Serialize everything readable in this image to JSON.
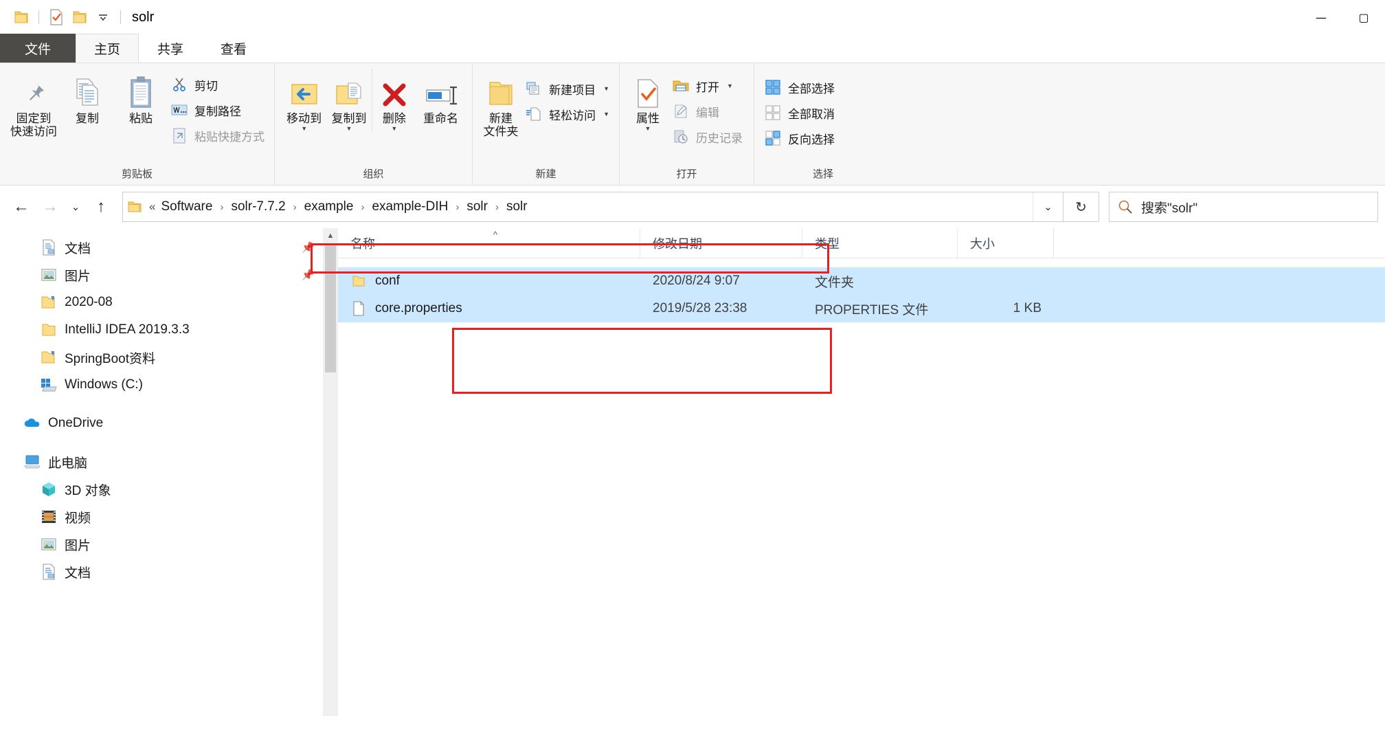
{
  "window": {
    "title": "solr",
    "quick_access": [
      "folder-icon",
      "properties-check-icon",
      "new-folder-icon",
      "chevron-down-icon"
    ],
    "caption": {
      "minimize": "—",
      "maximize": "▢"
    }
  },
  "tabs": [
    {
      "label": "文件",
      "name": "tab-file"
    },
    {
      "label": "主页",
      "name": "tab-home"
    },
    {
      "label": "共享",
      "name": "tab-share"
    },
    {
      "label": "查看",
      "name": "tab-view"
    }
  ],
  "active_tab": "主页",
  "ribbon": {
    "groups": [
      {
        "label": "剪贴板",
        "name": "ribbon-group-clipboard",
        "big_buttons": [
          {
            "label": "固定到\n快速访问",
            "icon": "pin-icon",
            "name": "pin-to-quick-access-button",
            "caret": false
          },
          {
            "label": "复制",
            "icon": "copy-icon",
            "name": "copy-button",
            "caret": false
          },
          {
            "label": "粘贴",
            "icon": "paste-icon",
            "name": "paste-button",
            "caret": false
          }
        ],
        "small_buttons": [
          {
            "label": "剪切",
            "icon": "scissors-icon",
            "name": "cut-button",
            "dim": false
          },
          {
            "label": "复制路径",
            "icon": "copy-path-icon",
            "name": "copy-path-button",
            "dim": false
          },
          {
            "label": "粘贴快捷方式",
            "icon": "paste-shortcut-icon",
            "name": "paste-shortcut-button",
            "dim": true
          }
        ]
      },
      {
        "label": "组织",
        "name": "ribbon-group-organize",
        "big_buttons": [
          {
            "label": "移动到",
            "icon": "move-to-icon",
            "name": "move-to-button",
            "caret": true
          },
          {
            "label": "复制到",
            "icon": "copy-to-icon",
            "name": "copy-to-button",
            "caret": true
          },
          {
            "label": "删除",
            "icon": "delete-x-icon",
            "name": "delete-button",
            "caret": true
          },
          {
            "label": "重命名",
            "icon": "rename-icon",
            "name": "rename-button",
            "caret": false
          }
        ],
        "small_buttons": []
      },
      {
        "label": "新建",
        "name": "ribbon-group-new",
        "big_buttons": [
          {
            "label": "新建\n文件夹",
            "icon": "new-folder-icon",
            "name": "new-folder-button",
            "caret": false
          }
        ],
        "small_buttons": [
          {
            "label": "新建项目",
            "icon": "new-item-icon",
            "name": "new-item-button",
            "dim": false,
            "caret": true
          },
          {
            "label": "轻松访问",
            "icon": "easy-access-icon",
            "name": "easy-access-button",
            "dim": false,
            "caret": true
          }
        ]
      },
      {
        "label": "打开",
        "name": "ribbon-group-open",
        "big_buttons": [
          {
            "label": "属性",
            "icon": "properties-icon",
            "name": "properties-button",
            "caret": true
          }
        ],
        "small_buttons": [
          {
            "label": "打开",
            "icon": "open-folder-icon",
            "name": "open-button",
            "dim": false,
            "caret": true
          },
          {
            "label": "编辑",
            "icon": "edit-pencil-icon",
            "name": "edit-button",
            "dim": true
          },
          {
            "label": "历史记录",
            "icon": "history-icon",
            "name": "history-button",
            "dim": true
          }
        ]
      },
      {
        "label": "选择",
        "name": "ribbon-group-select",
        "big_buttons": [],
        "small_buttons": [
          {
            "label": "全部选择",
            "icon": "select-all-icon",
            "name": "select-all-button",
            "dim": false
          },
          {
            "label": "全部取消",
            "icon": "select-none-icon",
            "name": "select-none-button",
            "dim": false
          },
          {
            "label": "反向选择",
            "icon": "invert-selection-icon",
            "name": "invert-selection-button",
            "dim": false
          }
        ]
      }
    ]
  },
  "address": {
    "back": "←",
    "forward": "→",
    "recent": "⌄",
    "up": "↑",
    "root_glyph": "«",
    "crumbs": [
      "Software",
      "solr-7.7.2",
      "example",
      "example-DIH",
      "solr",
      "solr"
    ],
    "dropdown": "⌄",
    "refresh": "↻",
    "search_text": "搜索\"solr\"",
    "search_icon": "search-icon"
  },
  "nav_pane": {
    "items": [
      {
        "label": "文档",
        "icon": "documents-icon",
        "indent": 1,
        "pinned": true,
        "name": "nav-documents-quick"
      },
      {
        "label": "图片",
        "icon": "pictures-icon",
        "indent": 1,
        "pinned": true,
        "name": "nav-pictures-quick"
      },
      {
        "label": "2020-08",
        "icon": "folder-shortcut-icon",
        "indent": 1,
        "pinned": false,
        "name": "nav-2020-08"
      },
      {
        "label": "IntelliJ IDEA 2019.3.3",
        "icon": "folder-icon",
        "indent": 1,
        "pinned": false,
        "name": "nav-intellij-idea"
      },
      {
        "label": "SpringBoot资料",
        "icon": "folder-shortcut-icon",
        "indent": 1,
        "pinned": false,
        "name": "nav-springboot"
      },
      {
        "label": "Windows (C:)",
        "icon": "windows-drive-icon",
        "indent": 1,
        "pinned": false,
        "name": "nav-windows-c"
      },
      {
        "label": "__GAP__",
        "icon": "",
        "indent": 0,
        "pinned": false,
        "name": "nav-gap-1"
      },
      {
        "label": "OneDrive",
        "icon": "onedrive-icon",
        "indent": 0,
        "pinned": false,
        "name": "nav-onedrive"
      },
      {
        "label": "__GAP__",
        "icon": "",
        "indent": 0,
        "pinned": false,
        "name": "nav-gap-2"
      },
      {
        "label": "此电脑",
        "icon": "this-pc-icon",
        "indent": 0,
        "pinned": false,
        "name": "nav-this-pc"
      },
      {
        "label": "3D 对象",
        "icon": "3d-objects-icon",
        "indent": 1,
        "pinned": false,
        "name": "nav-3d-objects"
      },
      {
        "label": "视频",
        "icon": "videos-icon",
        "indent": 1,
        "pinned": false,
        "name": "nav-videos"
      },
      {
        "label": "图片",
        "icon": "pictures-icon",
        "indent": 1,
        "pinned": false,
        "name": "nav-pictures"
      },
      {
        "label": "文档",
        "icon": "documents-icon",
        "indent": 1,
        "pinned": false,
        "name": "nav-documents"
      }
    ]
  },
  "file_list": {
    "columns": [
      {
        "label": "名称",
        "name": "column-name",
        "sorted": true
      },
      {
        "label": "修改日期",
        "name": "column-date-modified",
        "sorted": false
      },
      {
        "label": "类型",
        "name": "column-type",
        "sorted": false
      },
      {
        "label": "大小",
        "name": "column-size",
        "sorted": false
      }
    ],
    "rows": [
      {
        "name": "conf",
        "date": "2020/8/24 9:07",
        "type": "文件夹",
        "size": "",
        "icon": "folder-icon",
        "selected": true
      },
      {
        "name": "core.properties",
        "date": "2019/5/28 23:38",
        "type": "PROPERTIES 文件",
        "size": "1 KB",
        "icon": "file-icon",
        "selected": true
      }
    ]
  },
  "annotations": {
    "highlight_color": "#e8201f",
    "boxes": [
      "address-path-highlight",
      "file-rows-highlight"
    ]
  }
}
